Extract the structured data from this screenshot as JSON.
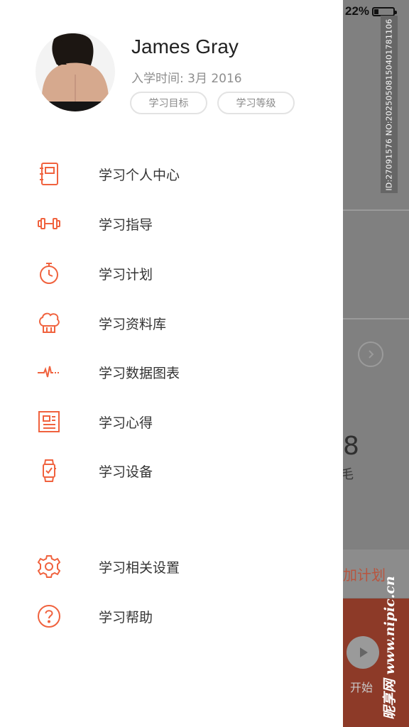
{
  "status": {
    "battery_percent_label": "22%",
    "battery_level": 0.22
  },
  "id_code": "ID:27091576 NO:20250508150401781106",
  "watermark": "昵享网 www.nipic.cn",
  "user": {
    "name": "James Gray",
    "enroll_label": "入学时间: 3月 2016",
    "tags": [
      "学习目标",
      "学习等级"
    ]
  },
  "menu": {
    "main": [
      {
        "label": "学习个人中心",
        "icon": "notebook-icon"
      },
      {
        "label": "学习指导",
        "icon": "dumbbell-icon"
      },
      {
        "label": "学习计划",
        "icon": "stopwatch-icon"
      },
      {
        "label": "学习资料库",
        "icon": "chef-hat-icon"
      },
      {
        "label": "学习数据图表",
        "icon": "pulse-icon"
      },
      {
        "label": "学习心得",
        "icon": "newspaper-icon"
      },
      {
        "label": "学习设备",
        "icon": "smartwatch-icon"
      }
    ],
    "secondary": [
      {
        "label": "学习相关设置",
        "icon": "gear-icon"
      },
      {
        "label": "学习帮助",
        "icon": "help-icon"
      }
    ]
  },
  "background": {
    "number": "8",
    "unit_fragment": "毛",
    "plan_fragment": "加计划",
    "start_label": "开始"
  },
  "colors": {
    "accent": "#F0623E",
    "overlay": "#808080",
    "band": "#8D3A28"
  }
}
